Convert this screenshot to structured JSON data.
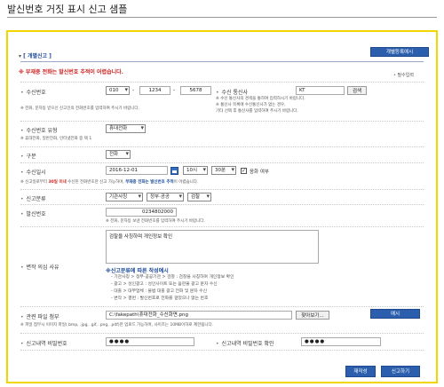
{
  "page": {
    "title": "발신번호 거짓 표시 신고 샘플"
  },
  "section": {
    "title": "[ 개별신고 ]",
    "register_button": "개별등록예시",
    "warning": "※ 부재중 전화는 발신번호 추적이 어렵습니다.",
    "required": "필수입력"
  },
  "receive_number": {
    "label": "수신번호",
    "area": "010",
    "mid": "1234",
    "last": "5678",
    "note": "※ 전화, 문자등 받으신 신고인의 전화번호를 입력하여 주시기 바랍니다."
  },
  "carrier": {
    "label": "수신 통신사",
    "value": "KT",
    "search_button": "검색",
    "notes": [
      "※ 수신 통신사의 경색을 통하여 입력하시기 바랍니다.",
      "※ 통신사 목록에 수신통신사가 없는 경우,",
      "  기타 선택 후 통신사를 입력하여 주시기 바랍니다."
    ]
  },
  "receive_type": {
    "label": "수신번호 유형",
    "value": "휴대전화",
    "note": "※ 휴대전화, 일반전화, 인터넷전화 중 택 1"
  },
  "category": {
    "label": "구분",
    "value": "전화"
  },
  "receive_time": {
    "label": "수신일시",
    "date": "2016-12-01",
    "hour": "10시",
    "minute": "30분",
    "response_label": "응화 여부",
    "response_checked": "✓",
    "note_prefix": "※ 신고일로부터 ",
    "note_days": "30일 이내",
    "note_mid": " 수신된 전화번호만 신고 가능하며, ",
    "note_bold": "부재중 전화는 발신번호 추적",
    "note_suffix": "이 어렵습니다."
  },
  "report_category": {
    "label": "신고분류",
    "org": "기관사칭",
    "sub": "정부·공공",
    "detail": "검찰"
  },
  "sender_number": {
    "label": "발신번호",
    "value": "0234802000",
    "note": "※ 전화, 문자등 보낸 전화번호를 입력하여 주시기 바랍니다."
  },
  "suspicion": {
    "label": "변작 의심 사유",
    "text": "검찰을 사칭하며 개인정보 확인",
    "guide_title": "※신고분류에 따른 작성예시",
    "guides": [
      "- 기관사칭 > 정부·공공기관 > 검찰 : 검찰을 사칭하며 개인정보 확인",
      "- 광고 > 성인광고 : 성인사이트 또는 음란물 광고 문자 수신",
      "- 대출 > 대부업체 : 불법 대출 광고 전화 및 문자 수신",
      "- 변작 > 결번 : 발신번호로 전화를 걸었으나 없는 번호"
    ]
  },
  "attachment": {
    "label": "관련 파일 첨부",
    "value": "C:\\fakepath\\휴대전화_수신화면.png",
    "browse_button": "찾아보기...",
    "example_button": "예시",
    "note": "※ 파일 첨부시 이미지 파일(.bmp, .jpg, .gif, .png, .pdf)만 업로드 가능하며, 사이즈는 10MB이하로 제한됩니다."
  },
  "password": {
    "label": "신고내역 비밀번호",
    "value": "●●●●"
  },
  "password_confirm": {
    "label": "신고내역 비밀번호 확인",
    "value": "●●●●"
  },
  "actions": {
    "rewrite": "재작성",
    "submit": "신고하기"
  },
  "colors": {
    "frame": "#f2d600",
    "primary": "#2b5fae",
    "warning": "#d02020"
  }
}
